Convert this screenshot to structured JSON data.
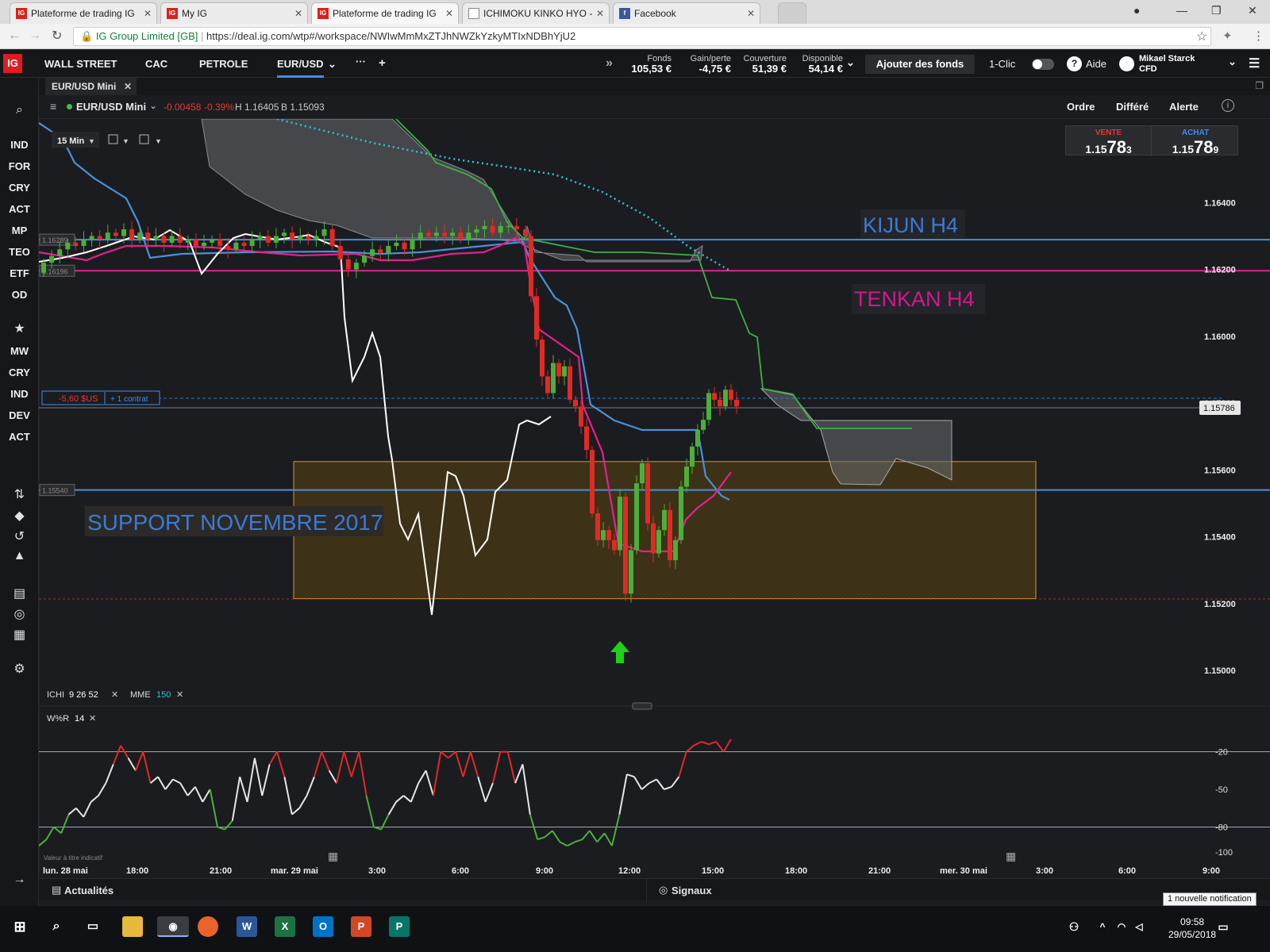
{
  "browser": {
    "tabs": [
      {
        "title": "Plateforme de trading IG",
        "icon": "ig-favicon",
        "active": false
      },
      {
        "title": "My IG",
        "icon": "ig-favicon",
        "active": false
      },
      {
        "title": "Plateforme de trading IG",
        "icon": "ig-favicon",
        "active": true
      },
      {
        "title": "ICHIMOKU KINKO HYO -",
        "icon": "doc-favicon",
        "active": false
      },
      {
        "title": "Facebook",
        "icon": "facebook-favicon",
        "active": false
      }
    ],
    "secure_label": "IG Group Limited [GB]",
    "url": "https://deal.ig.com/wtp#/workspace/NWIwMmMxZTJhNWZkYzkyMTIxNDBhYjU2"
  },
  "app": {
    "logo": "IG",
    "markets": [
      "WALL STREET",
      "CAC",
      "PETROLE",
      "EUR/USD"
    ],
    "active_market": "EUR/USD",
    "account": [
      {
        "label": "Fonds",
        "value": "105,53 €"
      },
      {
        "label": "Gain/perte",
        "value": "-4,75 €"
      },
      {
        "label": "Couverture",
        "value": "51,39 €"
      },
      {
        "label": "Disponible",
        "value": "54,14 €"
      }
    ],
    "add_funds": "Ajouter des fonds",
    "one_click": "1-Clic",
    "help": "Aide",
    "user_name": "Mikael Starck",
    "user_account": "CFD"
  },
  "left_toolbar": {
    "group1": [
      "IND",
      "FOR",
      "CRY",
      "ACT",
      "MP",
      "TEO",
      "ETF",
      "OD"
    ],
    "group2": [
      "MW",
      "CRY",
      "IND",
      "DEV",
      "ACT"
    ]
  },
  "chart_panel": {
    "tab": "EUR/USD Mini",
    "instrument": "EUR/USD Mini",
    "change": "-0.00458",
    "change_pct": "-0.39%",
    "high": "H 1.16405",
    "low": "B 1.15093",
    "buttons": [
      "Ordre",
      "Différé",
      "Alerte"
    ],
    "timeframe": "15 Min",
    "sell_label": "VENTE",
    "sell_price": {
      "a": "1.15",
      "b": "78",
      "c": "3"
    },
    "buy_label": "ACHAT",
    "buy_price": {
      "a": "1.15",
      "b": "78",
      "c": "9"
    },
    "position_pl": "-5,60 $US",
    "position_size": "+ 1 contrat",
    "indicator_main": {
      "name": "ICHI",
      "params": "9  26  52",
      "mme": "MME",
      "mme_period": "150"
    },
    "indicator_sub": {
      "name": "W%R",
      "period": "14"
    },
    "disclaimer": "Valeur à titre indicatif",
    "bottom_left": "Actualités",
    "bottom_right": "Signaux"
  },
  "colors": {
    "bg": "#1b1c20",
    "up_candle": "#4caf3a",
    "down_candle": "#e02a24",
    "kijun": "#4a90d9",
    "tenkan": "#e0238c",
    "chikou": "#ffffff",
    "ssb": "#3fae49",
    "mme150": "#2ec4d8",
    "zone_fill": "#4a3a14",
    "zone_border": "#d49a2a"
  },
  "chart_data": {
    "type": "candlestick",
    "price_axis": {
      "ticks": [
        "1.16400",
        "1.16200",
        "1.16000",
        "1.15800",
        "1.15600",
        "1.15400",
        "1.15200",
        "1.15000"
      ],
      "ylim": [
        1.1496,
        1.1665
      ]
    },
    "time_axis": [
      "lun. 28 mai",
      "18:00",
      "21:00",
      "mar. 29 mai",
      "3:00",
      "6:00",
      "9:00",
      "12:00",
      "15:00",
      "18:00",
      "21:00",
      "mer. 30 mai",
      "3:00",
      "6:00",
      "9:00"
    ],
    "current_price": "1.15786",
    "levels": [
      {
        "label": "1.16289",
        "value": 1.16289
      },
      {
        "label": "1.16196",
        "value": 1.16196
      },
      {
        "label": "1.15540",
        "value": 1.1554
      }
    ],
    "annotations": [
      {
        "text": "KIJUN H4",
        "color": "#3a7bd5"
      },
      {
        "text": "TENKAN H4",
        "color": "#d0198a"
      },
      {
        "text": "SUPPORT NOVEMBRE 2017",
        "color": "#3a7bd5"
      }
    ],
    "support_zone": [
      1.15215,
      1.15625
    ],
    "series": [
      {
        "name": "close",
        "values": [
          1.1622,
          1.1624,
          1.1626,
          1.1628,
          1.1627,
          1.1629,
          1.163,
          1.1629,
          1.1631,
          1.163,
          1.1632,
          1.1629,
          1.1631,
          1.1629,
          1.163,
          1.1628,
          1.163,
          1.1628,
          1.1629,
          1.1627,
          1.1628,
          1.1629,
          1.1627,
          1.1626,
          1.1628,
          1.1627,
          1.1629,
          1.163,
          1.1628,
          1.163,
          1.1631,
          1.1629,
          1.163,
          1.1629,
          1.163,
          1.1632,
          1.1627,
          1.1623,
          1.162,
          1.1622,
          1.1624,
          1.1626,
          1.1625,
          1.1627,
          1.1628,
          1.1626,
          1.1629,
          1.1631,
          1.163,
          1.1631,
          1.163,
          1.1631,
          1.1629,
          1.1631,
          1.1632,
          1.1633,
          1.1631,
          1.1633,
          1.1633,
          1.1632,
          1.163,
          1.1612,
          1.1599,
          1.1588,
          1.1583,
          1.1592,
          1.1588,
          1.1591,
          1.1581,
          1.1579,
          1.1573,
          1.1566,
          1.1547,
          1.1539,
          1.1542,
          1.1539,
          1.1536,
          1.1552,
          1.1523,
          1.1536,
          1.1556,
          1.1562,
          1.1544,
          1.1535,
          1.1542,
          1.1548,
          1.1533,
          1.1539,
          1.1555,
          1.1561,
          1.1567,
          1.1572,
          1.1575,
          1.1583,
          1.1581,
          1.1579,
          1.1584,
          1.1581,
          1.1579
        ]
      }
    ],
    "williams_r": {
      "values": [
        -95,
        -90,
        -80,
        -85,
        -70,
        -65,
        -72,
        -60,
        -55,
        -45,
        -30,
        -15,
        -25,
        -35,
        -20,
        -45,
        -40,
        -50,
        -42,
        -45,
        -55,
        -48,
        -60,
        -50,
        -80,
        -82,
        -75,
        -40,
        -60,
        -25,
        -55,
        -30,
        -20,
        -40,
        -70,
        -65,
        -55,
        -40,
        -20,
        -35,
        -45,
        -20,
        -40,
        -20,
        -55,
        -80,
        -82,
        -70,
        -60,
        -55,
        -60,
        -45,
        -35,
        -55,
        -20,
        -25,
        -20,
        -40,
        -20,
        -40,
        -60,
        -45,
        -20,
        -20,
        -45,
        -30,
        -70,
        -90,
        -88,
        -83,
        -92,
        -95,
        -92,
        -90,
        -83,
        -92,
        -85,
        -95,
        -70,
        -38,
        -40,
        -50,
        -45,
        -42,
        -50,
        -48,
        -40,
        -20,
        -15,
        -12,
        -14,
        -12,
        -20,
        -10
      ],
      "ticks": [
        "-20",
        "-50",
        "-80",
        "-100"
      ],
      "levels": [
        -20,
        -80
      ]
    }
  }
}
